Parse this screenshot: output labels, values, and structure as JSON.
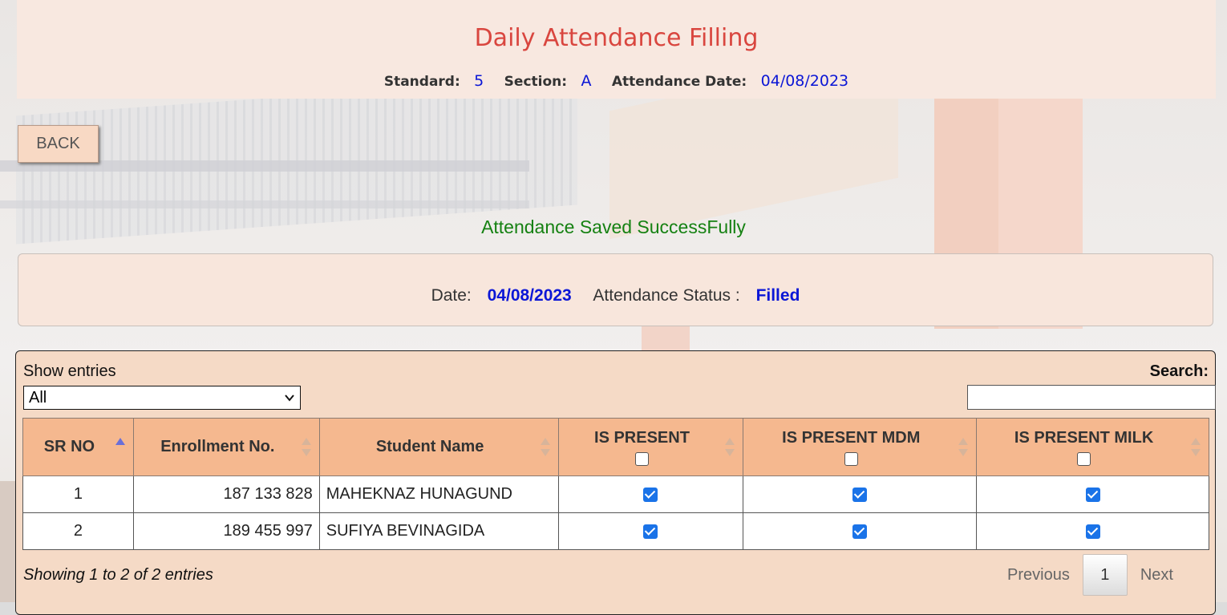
{
  "header": {
    "title": "Daily Attendance Filling",
    "standard_label": "Standard:",
    "standard_value": "5",
    "section_label": "Section:",
    "section_value": "A",
    "date_label": "Attendance Date:",
    "date_value": "04/08/2023"
  },
  "back_button": "BACK",
  "message": "Attendance Saved SuccessFully",
  "status": {
    "date_label": "Date:",
    "date_value": "04/08/2023",
    "status_label": "Attendance Status :",
    "status_value": "Filled"
  },
  "table_controls": {
    "show_entries_label": "Show entries",
    "entries_selected": "All",
    "search_label": "Search:",
    "search_value": ""
  },
  "table": {
    "columns": [
      "SR NO",
      "Enrollment No.",
      "Student Name",
      "IS PRESENT",
      "IS PRESENT MDM",
      "IS PRESENT MILK"
    ],
    "rows": [
      {
        "sr": "1",
        "enrollment": "187 133 828",
        "name": "MAHEKNAZ HUNAGUND",
        "present": true,
        "mdm": true,
        "milk": true
      },
      {
        "sr": "2",
        "enrollment": "189 455 997",
        "name": "SUFIYA BEVINAGIDA",
        "present": true,
        "mdm": true,
        "milk": true
      }
    ]
  },
  "footer": {
    "info": "Showing 1 to 2 of 2 entries",
    "previous": "Previous",
    "page": "1",
    "next": "Next"
  },
  "colors": {
    "title": "#d9463f",
    "value_blue": "#0b16d6",
    "success_green": "#158112",
    "header_bg": "#f5b88f",
    "panel_bg": "#f5dac6"
  }
}
